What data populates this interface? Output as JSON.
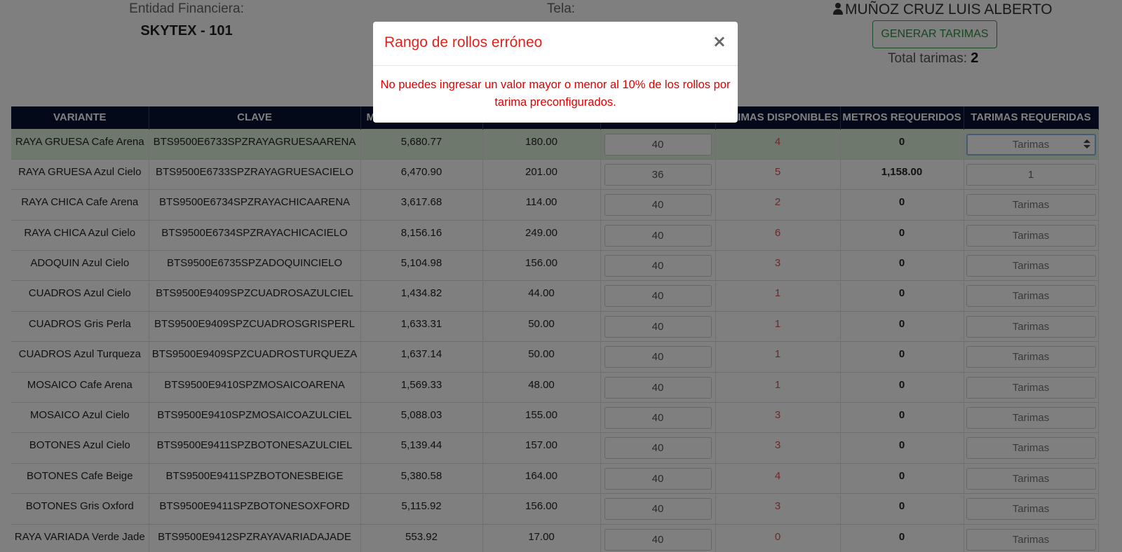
{
  "header": {
    "entidad_label": "Entidad Financiera:",
    "entidad_value": "SKYTEX - 101",
    "tela_label": "Tela:",
    "user_name": "MUÑOZ CRUZ LUIS ALBERTO",
    "generar_button": "GENERAR TARIMAS",
    "total_label": "Total tarimas:",
    "total_value": "2"
  },
  "table": {
    "columns": [
      "VARIANTE",
      "CLAVE",
      "M",
      "",
      "",
      "RIMAS DISPONIBLES",
      "METROS REQUERIDOS",
      "TARIMAS REQUERIDAS"
    ],
    "placeholder": "Tarimas",
    "rows": [
      {
        "variante": "RAYA GRUESA Cafe Arena",
        "clave": "BTS9500E6733SPZRAYAGRUESAARENA",
        "metros": "5,680.77",
        "rollos": "180.00",
        "por_tarima": "40",
        "disponibles": "4",
        "metros_req": "0",
        "tarimas_req": ""
      },
      {
        "variante": "RAYA GRUESA Azul Cielo",
        "clave": "BTS9500E6733SPZRAYAGRUESACIELO",
        "metros": "6,470.90",
        "rollos": "201.00",
        "por_tarima": "36",
        "disponibles": "5",
        "metros_req": "1,158.00",
        "tarimas_req": "1"
      },
      {
        "variante": "RAYA CHICA Cafe Arena",
        "clave": "BTS9500E6734SPZRAYACHICAARENA",
        "metros": "3,617.68",
        "rollos": "114.00",
        "por_tarima": "40",
        "disponibles": "2",
        "metros_req": "0",
        "tarimas_req": ""
      },
      {
        "variante": "RAYA CHICA Azul Cielo",
        "clave": "BTS9500E6734SPZRAYACHICACIELO",
        "metros": "8,156.16",
        "rollos": "249.00",
        "por_tarima": "40",
        "disponibles": "6",
        "metros_req": "0",
        "tarimas_req": ""
      },
      {
        "variante": "ADOQUIN Azul Cielo",
        "clave": "BTS9500E6735SPZADOQUINCIELO",
        "metros": "5,104.98",
        "rollos": "156.00",
        "por_tarima": "40",
        "disponibles": "3",
        "metros_req": "0",
        "tarimas_req": ""
      },
      {
        "variante": "CUADROS Azul Cielo",
        "clave": "BTS9500E9409SPZCUADROSAZULCIEL",
        "metros": "1,434.82",
        "rollos": "44.00",
        "por_tarima": "40",
        "disponibles": "1",
        "metros_req": "0",
        "tarimas_req": ""
      },
      {
        "variante": "CUADROS Gris Perla",
        "clave": "BTS9500E9409SPZCUADROSGRISPERL",
        "metros": "1,633.31",
        "rollos": "50.00",
        "por_tarima": "40",
        "disponibles": "1",
        "metros_req": "0",
        "tarimas_req": ""
      },
      {
        "variante": "CUADROS Azul Turqueza",
        "clave": "BTS9500E9409SPZCUADROSTURQUEZA",
        "metros": "1,637.14",
        "rollos": "50.00",
        "por_tarima": "40",
        "disponibles": "1",
        "metros_req": "0",
        "tarimas_req": ""
      },
      {
        "variante": "MOSAICO Cafe Arena",
        "clave": "BTS9500E9410SPZMOSAICOARENA",
        "metros": "1,569.33",
        "rollos": "48.00",
        "por_tarima": "40",
        "disponibles": "1",
        "metros_req": "0",
        "tarimas_req": ""
      },
      {
        "variante": "MOSAICO Azul Cielo",
        "clave": "BTS9500E9410SPZMOSAICOAZULCIEL",
        "metros": "5,088.03",
        "rollos": "155.00",
        "por_tarima": "40",
        "disponibles": "3",
        "metros_req": "0",
        "tarimas_req": ""
      },
      {
        "variante": "BOTONES Azul Cielo",
        "clave": "BTS9500E9411SPZBOTONESAZULCIEL",
        "metros": "5,139.44",
        "rollos": "157.00",
        "por_tarima": "40",
        "disponibles": "3",
        "metros_req": "0",
        "tarimas_req": ""
      },
      {
        "variante": "BOTONES Cafe Beige",
        "clave": "BTS9500E9411SPZBOTONESBEIGE",
        "metros": "5,380.58",
        "rollos": "164.00",
        "por_tarima": "40",
        "disponibles": "4",
        "metros_req": "0",
        "tarimas_req": ""
      },
      {
        "variante": "BOTONES Gris Oxford",
        "clave": "BTS9500E9411SPZBOTONESOXFORD",
        "metros": "5,115.92",
        "rollos": "156.00",
        "por_tarima": "40",
        "disponibles": "3",
        "metros_req": "0",
        "tarimas_req": ""
      },
      {
        "variante": "RAYA VARIADA Verde Jade",
        "clave": "BTS9500E9412SPZRAYAVARIADAJADE",
        "metros": "553.92",
        "rollos": "17.00",
        "por_tarima": "40",
        "disponibles": "0",
        "metros_req": "0",
        "tarimas_req": ""
      }
    ]
  },
  "modal": {
    "title": "Rango de rollos erróneo",
    "close": "×",
    "message": "No puedes ingresar un valor mayor o menor al 10% de los rollos por tarima preconfigurados."
  },
  "colors": {
    "header_bg": "#061230",
    "selected_row": "#dff0d8",
    "available_text": "#d9534f",
    "modal_title": "#e0231c",
    "modal_message": "#e00000",
    "button_green": "#2f8c40"
  }
}
